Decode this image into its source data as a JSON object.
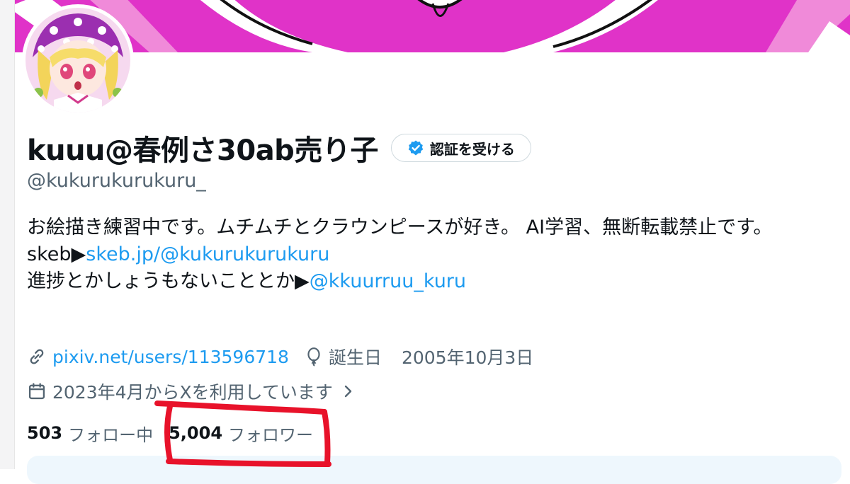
{
  "profile": {
    "display_name": "kuuu@春例さ30ab売り子",
    "handle": "@kukurukurukuru_",
    "verify_button_label": "認証を受ける"
  },
  "bio": {
    "line1": "お絵描き練習中です。ムチムチとクラウンピースが好き。 AI学習、無断転載禁止です。",
    "skeb_prefix": "skeb▶",
    "skeb_link": "skeb.jp/@kukurukurukuru",
    "progress_prefix": "進捗とかしょうもないこととか▶",
    "progress_link": "@kkuurruu_kuru"
  },
  "meta": {
    "website": "pixiv.net/users/113596718",
    "birthday_label": "誕生日",
    "birthday_value": "2005年10月3日",
    "joined": "2023年4月からXを利用しています"
  },
  "stats": {
    "following_count": "503",
    "following_label": "フォロー中",
    "followers_count": "5,004",
    "followers_label": "フォロワー"
  },
  "icons": {
    "verify": "verified-badge-icon",
    "website": "link-icon",
    "birthday": "balloon-icon",
    "joined": "calendar-icon",
    "more": "chevron-right-icon"
  },
  "colors": {
    "link": "#1d9bf0",
    "secondary_text": "#536471",
    "banner": "#e033c8",
    "annotation": "#e8122a"
  }
}
